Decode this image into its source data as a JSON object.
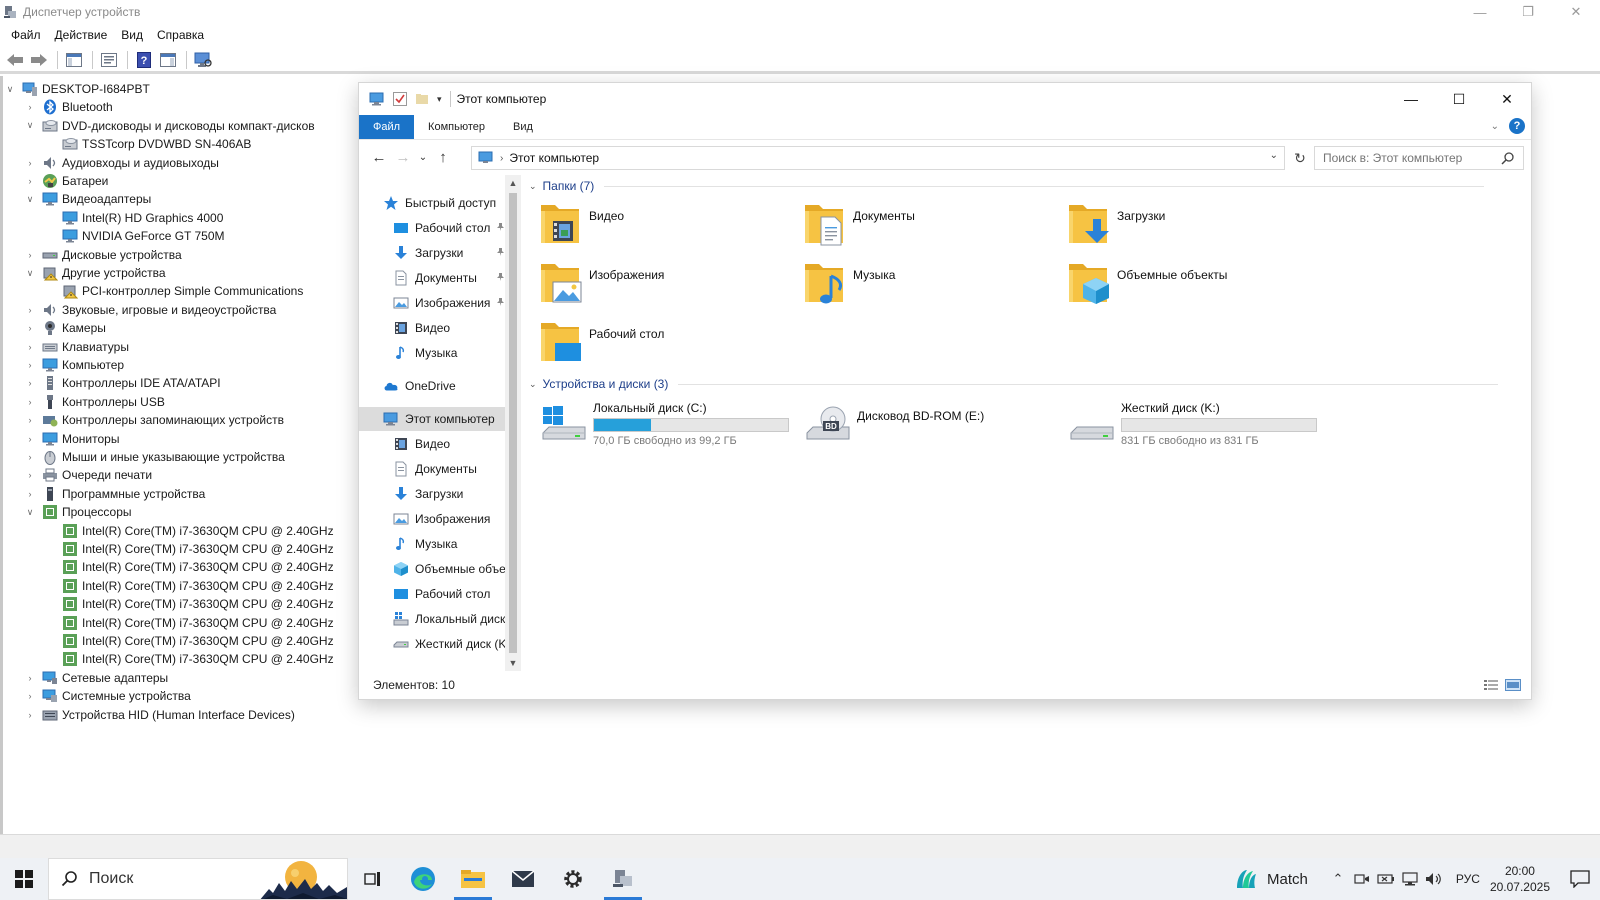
{
  "device_manager": {
    "title": "Диспетчер устройств",
    "menu": [
      "Файл",
      "Действие",
      "Вид",
      "Справка"
    ],
    "tree": [
      {
        "level": 0,
        "exp": "open",
        "icon": "computer",
        "label": "DESKTOP-I684PBT"
      },
      {
        "level": 1,
        "exp": "closed",
        "icon": "bluetooth",
        "label": "Bluetooth"
      },
      {
        "level": 1,
        "exp": "open",
        "icon": "dvd",
        "label": "DVD-дисководы и дисководы компакт-дисков"
      },
      {
        "level": 2,
        "exp": "none",
        "icon": "dvd",
        "label": "TSSTcorp DVDWBD SN-406AB"
      },
      {
        "level": 1,
        "exp": "closed",
        "icon": "speaker",
        "label": "Аудиовходы и аудиовыходы"
      },
      {
        "level": 1,
        "exp": "closed",
        "icon": "battery",
        "label": "Батареи"
      },
      {
        "level": 1,
        "exp": "open",
        "icon": "monitor",
        "label": "Видеоадаптеры"
      },
      {
        "level": 2,
        "exp": "none",
        "icon": "monitor",
        "label": "Intel(R) HD Graphics 4000"
      },
      {
        "level": 2,
        "exp": "none",
        "icon": "monitor",
        "label": "NVIDIA GeForce GT 750M"
      },
      {
        "level": 1,
        "exp": "closed",
        "icon": "disk",
        "label": "Дисковые устройства"
      },
      {
        "level": 1,
        "exp": "open",
        "icon": "unknown",
        "label": "Другие устройства"
      },
      {
        "level": 2,
        "exp": "none",
        "icon": "unknown",
        "label": "PCI-контроллер Simple Communications"
      },
      {
        "level": 1,
        "exp": "closed",
        "icon": "speaker",
        "label": "Звуковые, игровые и видеоустройства"
      },
      {
        "level": 1,
        "exp": "closed",
        "icon": "camera",
        "label": "Камеры"
      },
      {
        "level": 1,
        "exp": "closed",
        "icon": "keyboard",
        "label": "Клавиатуры"
      },
      {
        "level": 1,
        "exp": "closed",
        "icon": "monitor",
        "label": "Компьютер"
      },
      {
        "level": 1,
        "exp": "closed",
        "icon": "ide",
        "label": "Контроллеры IDE ATA/ATAPI"
      },
      {
        "level": 1,
        "exp": "closed",
        "icon": "usb",
        "label": "Контроллеры USB"
      },
      {
        "level": 1,
        "exp": "closed",
        "icon": "storage",
        "label": "Контроллеры запоминающих устройств"
      },
      {
        "level": 1,
        "exp": "closed",
        "icon": "monitor",
        "label": "Мониторы"
      },
      {
        "level": 1,
        "exp": "closed",
        "icon": "mouse",
        "label": "Мыши и иные указывающие устройства"
      },
      {
        "level": 1,
        "exp": "closed",
        "icon": "printer",
        "label": "Очереди печати"
      },
      {
        "level": 1,
        "exp": "closed",
        "icon": "software",
        "label": "Программные устройства"
      },
      {
        "level": 1,
        "exp": "open",
        "icon": "cpu",
        "label": "Процессоры"
      },
      {
        "level": 2,
        "exp": "none",
        "icon": "cpu",
        "label": "Intel(R) Core(TM) i7-3630QM CPU @ 2.40GHz"
      },
      {
        "level": 2,
        "exp": "none",
        "icon": "cpu",
        "label": "Intel(R) Core(TM) i7-3630QM CPU @ 2.40GHz"
      },
      {
        "level": 2,
        "exp": "none",
        "icon": "cpu",
        "label": "Intel(R) Core(TM) i7-3630QM CPU @ 2.40GHz"
      },
      {
        "level": 2,
        "exp": "none",
        "icon": "cpu",
        "label": "Intel(R) Core(TM) i7-3630QM CPU @ 2.40GHz"
      },
      {
        "level": 2,
        "exp": "none",
        "icon": "cpu",
        "label": "Intel(R) Core(TM) i7-3630QM CPU @ 2.40GHz"
      },
      {
        "level": 2,
        "exp": "none",
        "icon": "cpu",
        "label": "Intel(R) Core(TM) i7-3630QM CPU @ 2.40GHz"
      },
      {
        "level": 2,
        "exp": "none",
        "icon": "cpu",
        "label": "Intel(R) Core(TM) i7-3630QM CPU @ 2.40GHz"
      },
      {
        "level": 2,
        "exp": "none",
        "icon": "cpu",
        "label": "Intel(R) Core(TM) i7-3630QM CPU @ 2.40GHz"
      },
      {
        "level": 1,
        "exp": "closed",
        "icon": "network",
        "label": "Сетевые адаптеры"
      },
      {
        "level": 1,
        "exp": "closed",
        "icon": "system",
        "label": "Системные устройства"
      },
      {
        "level": 1,
        "exp": "closed",
        "icon": "hid",
        "label": "Устройства HID (Human Interface Devices)"
      }
    ]
  },
  "explorer": {
    "title": "Этот компьютер",
    "ribbon_tabs": [
      "Файл",
      "Компьютер",
      "Вид"
    ],
    "address": "Этот компьютер",
    "search_placeholder": "Поиск в: Этот компьютер",
    "nav": [
      {
        "icon": "star",
        "label": "Быстрый доступ",
        "indent": 0,
        "pin": false,
        "selected": false
      },
      {
        "icon": "desktop",
        "label": "Рабочий стол",
        "indent": 1,
        "pin": true,
        "selected": false
      },
      {
        "icon": "download",
        "label": "Загрузки",
        "indent": 1,
        "pin": true,
        "selected": false
      },
      {
        "icon": "document",
        "label": "Документы",
        "indent": 1,
        "pin": true,
        "selected": false
      },
      {
        "icon": "picture",
        "label": "Изображения",
        "indent": 1,
        "pin": true,
        "selected": false
      },
      {
        "icon": "video",
        "label": "Видео",
        "indent": 1,
        "pin": false,
        "selected": false
      },
      {
        "icon": "music",
        "label": "Музыка",
        "indent": 1,
        "pin": false,
        "selected": false
      },
      {
        "icon": "cloud",
        "label": "OneDrive",
        "indent": 0,
        "pin": false,
        "selected": false
      },
      {
        "icon": "pc",
        "label": "Этот компьютер",
        "indent": 0,
        "pin": false,
        "selected": true
      },
      {
        "icon": "video",
        "label": "Видео",
        "indent": 1,
        "pin": false,
        "selected": false
      },
      {
        "icon": "document",
        "label": "Документы",
        "indent": 1,
        "pin": false,
        "selected": false
      },
      {
        "icon": "download",
        "label": "Загрузки",
        "indent": 1,
        "pin": false,
        "selected": false
      },
      {
        "icon": "picture",
        "label": "Изображения",
        "indent": 1,
        "pin": false,
        "selected": false
      },
      {
        "icon": "music",
        "label": "Музыка",
        "indent": 1,
        "pin": false,
        "selected": false
      },
      {
        "icon": "cube",
        "label": "Объемные объекты",
        "indent": 1,
        "pin": false,
        "selected": false
      },
      {
        "icon": "desktop",
        "label": "Рабочий стол",
        "indent": 1,
        "pin": false,
        "selected": false
      },
      {
        "icon": "drive-win",
        "label": "Локальный диск (C:)",
        "indent": 1,
        "pin": false,
        "selected": false
      },
      {
        "icon": "drive",
        "label": "Жесткий диск (K:)",
        "indent": 1,
        "pin": false,
        "selected": false
      }
    ],
    "folders_header": "Папки (7)",
    "folders": [
      {
        "name": "Видео",
        "icon": "video"
      },
      {
        "name": "Документы",
        "icon": "document"
      },
      {
        "name": "Загрузки",
        "icon": "download"
      },
      {
        "name": "Изображения",
        "icon": "picture"
      },
      {
        "name": "Музыка",
        "icon": "music"
      },
      {
        "name": "Объемные объекты",
        "icon": "cube"
      },
      {
        "name": "Рабочий стол",
        "icon": "desktop"
      }
    ],
    "drives_header": "Устройства и диски (3)",
    "drives": [
      {
        "name": "Локальный диск (C:)",
        "icon": "drive-win",
        "free": "70,0 ГБ свободно из 99,2 ГБ",
        "used_fraction": 0.294,
        "has_bar": true
      },
      {
        "name": "Дисковод BD-ROM (E:)",
        "icon": "bd",
        "free": "",
        "used_fraction": 0,
        "has_bar": false
      },
      {
        "name": "Жесткий диск (K:)",
        "icon": "drive",
        "free": "831 ГБ свободно из 831 ГБ",
        "used_fraction": 0.0,
        "has_bar": true
      }
    ],
    "status": "Элементов: 10"
  },
  "taskbar": {
    "search_label": "Поиск",
    "weather_label": "Match",
    "language": "РУС",
    "time": "20:00",
    "date": "20.07.2025"
  },
  "colors": {
    "accent": "#1a73c8",
    "folder": "#f6c343",
    "drive_bar": "#26a0da"
  }
}
